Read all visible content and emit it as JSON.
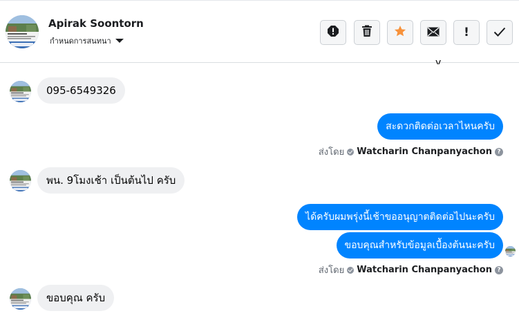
{
  "header": {
    "contact_name": "Apirak Soontorn",
    "settings_label": "กำหนดการสนทนา",
    "actions": [
      {
        "name": "report-spam-icon",
        "color": "#1c1e21"
      },
      {
        "name": "trash-icon",
        "color": "#1c1e21"
      },
      {
        "name": "star-icon",
        "color": "#f7923b"
      },
      {
        "name": "mail-icon",
        "color": "#1c1e21"
      },
      {
        "name": "exclamation-icon",
        "label": "!"
      },
      {
        "name": "checkmark-icon",
        "color": "#1c1e21"
      }
    ]
  },
  "conversation": {
    "partial_top_text": "y",
    "messages": [
      {
        "direction": "incoming",
        "text": "095-6549326"
      },
      {
        "direction": "outgoing",
        "text": "สะดวกติดต่อเวลาไหนครับ"
      },
      {
        "direction": "sent_by",
        "prefix": "ส่งโดย",
        "agent": "Watcharin Chanpanyachon"
      },
      {
        "direction": "incoming",
        "text": "พน. 9โมงเช้า เป็นต้นไป ครับ"
      },
      {
        "direction": "outgoing",
        "text": "ได้ครับผมพรุ่งนี้เช้าขออนุญาตติดต่อไปนะครับ"
      },
      {
        "direction": "outgoing",
        "text": "ขอบคุณสำหรับข้อมูลเบื้องต้นนะครับ"
      },
      {
        "direction": "sent_by",
        "prefix": "ส่งโดย",
        "agent": "Watcharin Chanpanyachon"
      },
      {
        "direction": "incoming",
        "text": "ขอบคุณ ครับ"
      }
    ],
    "help_glyph": "?"
  },
  "colors": {
    "outgoing_bubble": "#0084ff",
    "incoming_bubble": "#eff0f2",
    "star": "#f7923b"
  }
}
